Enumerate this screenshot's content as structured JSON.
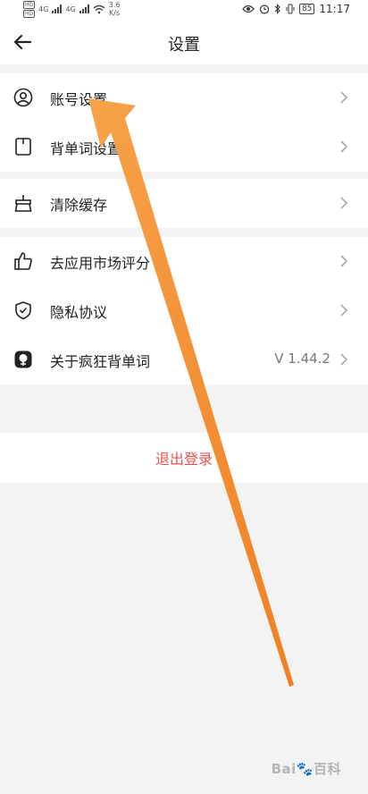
{
  "status_bar": {
    "hd1": "HD",
    "hd2": "HD",
    "net1": "4G",
    "net2": "4G",
    "speed_value": "3.6",
    "speed_unit": "K/s",
    "battery": "85",
    "time": "11:17"
  },
  "header": {
    "title": "设置",
    "back_icon": "arrow-left-icon"
  },
  "groups": [
    {
      "items": [
        {
          "label": "账号设置",
          "icon": "user-circle-icon"
        },
        {
          "label": "背单词设置",
          "icon": "bookmark-icon"
        }
      ]
    },
    {
      "items": [
        {
          "label": "清除缓存",
          "icon": "broom-icon"
        }
      ]
    },
    {
      "items": [
        {
          "label": "去应用市场评分",
          "icon": "thumbs-up-icon"
        },
        {
          "label": "隐私协议",
          "icon": "shield-check-icon"
        },
        {
          "label": "关于疯狂背单词",
          "icon": "app-logo-icon",
          "value": "V 1.44.2"
        }
      ]
    }
  ],
  "logout": {
    "label": "退出登录"
  },
  "colors": {
    "background": "#f3f3f3",
    "logout_text": "#e5534b",
    "annotation_arrow": "#f08a30"
  },
  "watermark": {
    "text": "Bai🐾百科"
  }
}
